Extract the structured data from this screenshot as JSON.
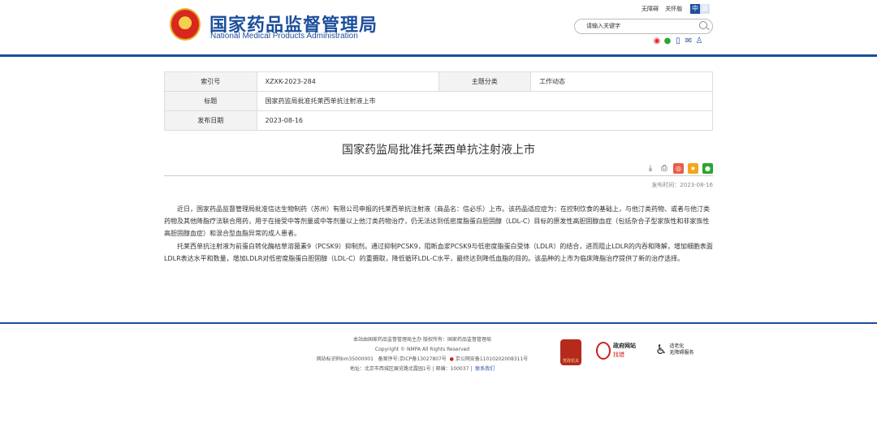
{
  "header": {
    "site_name_cn": "国家药品监督管理局",
    "site_name_en": "National Medical Products Administration",
    "links": [
      "无障碍",
      "关怀版"
    ],
    "lang": [
      "中",
      "英"
    ],
    "search_placeholder": "请输入关键字"
  },
  "meta": {
    "index_label": "索引号",
    "index_value": "XZXK-2023-284",
    "category_label": "主题分类",
    "category_value": "工作动态",
    "title_label": "标题",
    "title_value": "国家药监局批准托莱西单抗注射液上市",
    "date_label": "发布日期",
    "date_value": "2023-08-16"
  },
  "article": {
    "title": "国家药监局批准托莱西单抗注射液上市",
    "pub_time": "发布时间：2023-08-16",
    "paragraphs": [
      "近日，国家药品监督管理局批准信达生物制药（苏州）有限公司申报的托莱西单抗注射液（商品名：信必乐）上市。该药品适应症为：在控制饮食的基础上，与他汀类药物、或者与他汀类药物及其他降脂疗法联合用药，用于在接受中等剂量或中等剂量以上他汀类药物治疗，仍无法达到低密度脂蛋白胆固醇（LDL-C）目标的原发性高胆固醇血症（包括杂合子型家族性和非家族性高胆固醇血症）和混合型血脂异常的成人患者。",
      "托莱西单抗注射液为前蛋白转化酶枯草溶菌素9（PCSK9）抑制剂。通过抑制PCSK9，阻断血浆PCSK9与低密度脂蛋白受体（LDLR）的结合，进而阻止LDLR的内吞和降解，增加细胞表面LDLR表达水平和数量，增加LDLR对低密度脂蛋白胆固醇（LDL-C）的重摄取，降低循环LDL-C水平，最终达到降低血脂的目的。该品种的上市为临床降脂治疗提供了新的治疗选择。"
    ]
  },
  "footer": {
    "line1": "本站由国家药品监督管理局主办 版权所有：国家药品监督管理局",
    "line2": "Copyright © NMPA All Rights Reserved",
    "line3_a": "网站标识码bm35000001",
    "line3_b": "备案序号:京ICP备13027807号",
    "line3_c": "京公网安备11010202008311号",
    "line4_a": "地址：北京市西城区展览路北露园1号 | 邮编：100037 |",
    "line4_link": "联系我们",
    "badge": "党政机关",
    "gov_site_a": "政府网站",
    "gov_site_b": "找错",
    "accessibility_a": "适老化",
    "accessibility_b": "无障碍服务"
  }
}
